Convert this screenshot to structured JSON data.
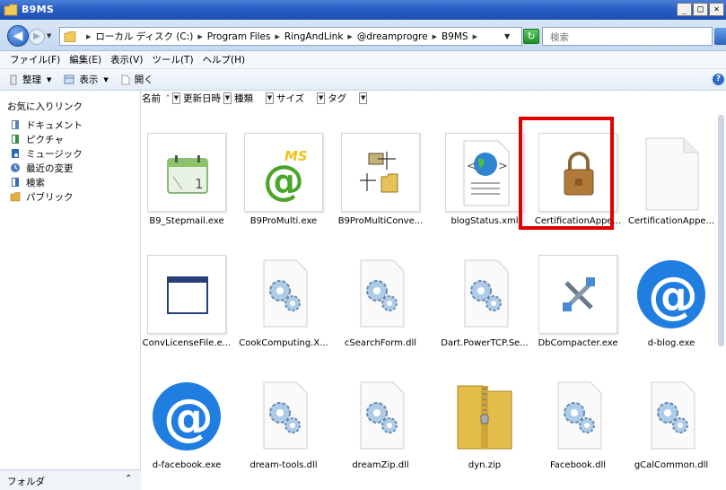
{
  "window": {
    "title": "B9MS"
  },
  "address": {
    "crumbs": [
      "ローカル ディスク (C:)",
      "Program Files",
      "RingAndLink",
      "@dreamprogre",
      "B9MS"
    ],
    "search_placeholder": "検索"
  },
  "menubar": [
    "ファイル(F)",
    "編集(E)",
    "表示(V)",
    "ツール(T)",
    "ヘルプ(H)"
  ],
  "toolbar": {
    "organize": "整理",
    "view": "表示",
    "open": "開く"
  },
  "favorites": {
    "title": "お気に入りリンク",
    "items": [
      {
        "label": "ドキュメント",
        "icon": "documents-icon",
        "color": "#5a7fb5"
      },
      {
        "label": "ピクチャ",
        "icon": "pictures-icon",
        "color": "#3d8a4a"
      },
      {
        "label": "ミュージック",
        "icon": "music-icon",
        "color": "#2a6ab8"
      },
      {
        "label": "最近の変更",
        "icon": "recent-changes-icon",
        "color": "#4d7cc2"
      },
      {
        "label": "検索",
        "icon": "search-icon",
        "color": "#3d6cb0"
      },
      {
        "label": "パブリック",
        "icon": "public-folder-icon",
        "color": "#e0b040"
      }
    ],
    "folder_label": "フォルダ"
  },
  "columns": [
    "名前",
    "更新日時",
    "種類",
    "サイズ",
    "タグ"
  ],
  "files": [
    {
      "name": "B9_Stepmail.exe",
      "icon": "calendar-icon"
    },
    {
      "name": "B9ProMulti.exe",
      "icon": "ms-at-icon"
    },
    {
      "name": "B9ProMultiConve...",
      "icon": "file-convert-icon"
    },
    {
      "name": "blogStatus.xml",
      "icon": "xml-globe-icon"
    },
    {
      "name": "CertificationAppe...",
      "icon": "lock-icon"
    },
    {
      "name": "CertificationAppe...",
      "icon": "blank-file-icon"
    },
    {
      "name": "ConvLicenseFile.e...",
      "icon": "window-app-icon"
    },
    {
      "name": "CookComputing.X...",
      "icon": "dll-gear-icon"
    },
    {
      "name": "cSearchForm.dll",
      "icon": "dll-gear-icon"
    },
    {
      "name": "Dart.PowerTCP.Se...",
      "icon": "dll-gear-icon"
    },
    {
      "name": "DbCompacter.exe",
      "icon": "tools-icon"
    },
    {
      "name": "d-blog.exe",
      "icon": "at-icon"
    },
    {
      "name": "d-facebook.exe",
      "icon": "at-icon"
    },
    {
      "name": "dream-tools.dll",
      "icon": "dll-gear-icon"
    },
    {
      "name": "dreamZip.dll",
      "icon": "dll-gear-icon"
    },
    {
      "name": "dyn.zip",
      "icon": "zip-folder-icon"
    },
    {
      "name": "Facebook.dll",
      "icon": "dll-gear-icon"
    },
    {
      "name": "gCalCommon.dll",
      "icon": "dll-gear-icon"
    }
  ],
  "colors": {
    "highlight": "#e00000",
    "titlebar": "#2a5fc4"
  }
}
